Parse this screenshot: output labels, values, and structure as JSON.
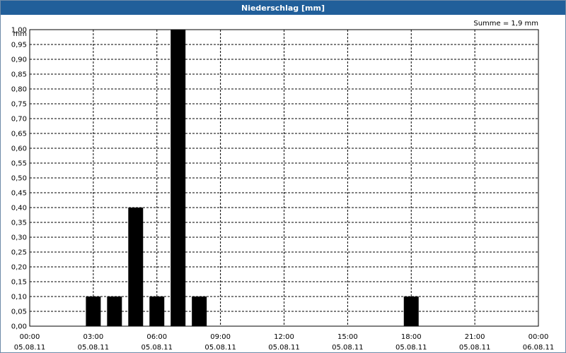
{
  "window": {
    "title": "Niederschlag [mm]"
  },
  "summary": {
    "text": "Summe = 1,9 mm"
  },
  "chart_data": {
    "type": "bar",
    "title": "Niederschlag [mm]",
    "ylabel": "mm",
    "xlabel": "",
    "ylim": [
      0,
      1.0
    ],
    "yticks": [
      "0,00",
      "0,05",
      "0,10",
      "0,15",
      "0,20",
      "0,25",
      "0,30",
      "0,35",
      "0,40",
      "0,45",
      "0,50",
      "0,55",
      "0,60",
      "0,65",
      "0,70",
      "0,75",
      "0,80",
      "0,85",
      "0,90",
      "0,95",
      "1,00"
    ],
    "xlim_hours": [
      0,
      24
    ],
    "xticks": [
      {
        "hour": 0,
        "time": "00:00",
        "date": "05.08.11"
      },
      {
        "hour": 3,
        "time": "03:00",
        "date": "05.08.11"
      },
      {
        "hour": 6,
        "time": "06:00",
        "date": "05.08.11"
      },
      {
        "hour": 9,
        "time": "09:00",
        "date": "05.08.11"
      },
      {
        "hour": 12,
        "time": "12:00",
        "date": "05.08.11"
      },
      {
        "hour": 15,
        "time": "15:00",
        "date": "05.08.11"
      },
      {
        "hour": 18,
        "time": "18:00",
        "date": "05.08.11"
      },
      {
        "hour": 21,
        "time": "21:00",
        "date": "05.08.11"
      },
      {
        "hour": 24,
        "time": "00:00",
        "date": "06.08.11"
      }
    ],
    "bars": [
      {
        "hour": 3,
        "value": 0.1
      },
      {
        "hour": 4,
        "value": 0.1
      },
      {
        "hour": 5,
        "value": 0.4
      },
      {
        "hour": 6,
        "value": 0.1
      },
      {
        "hour": 7,
        "value": 1.0
      },
      {
        "hour": 8,
        "value": 0.1
      },
      {
        "hour": 18,
        "value": 0.1
      }
    ],
    "grid": true,
    "bar_color": "#000000",
    "total": "Summe = 1,9 mm"
  }
}
